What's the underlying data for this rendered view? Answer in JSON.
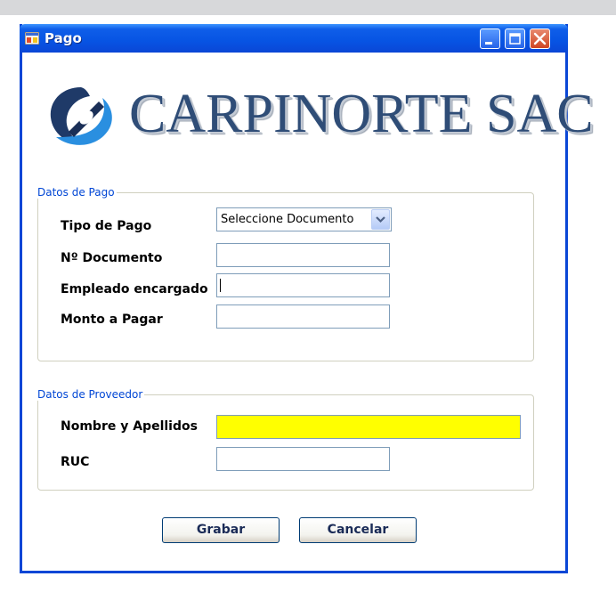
{
  "window": {
    "title": "Pago"
  },
  "logo": {
    "text": "CARPINORTE SAC"
  },
  "group_pago": {
    "legend": "Datos de Pago",
    "tipo_pago": {
      "label": "Tipo de Pago",
      "selected": "Seleccione Documento"
    },
    "num_documento": {
      "label": "Nº Documento",
      "value": ""
    },
    "empleado": {
      "label": "Empleado encargado",
      "value": ""
    },
    "monto": {
      "label": "Monto a Pagar",
      "value": ""
    }
  },
  "group_proveedor": {
    "legend": "Datos de Proveedor",
    "nombre": {
      "label": "Nombre y Apellidos",
      "value": "",
      "background": "#ffff00"
    },
    "ruc": {
      "label": "RUC",
      "value": ""
    }
  },
  "buttons": {
    "grabar": "Grabar",
    "cancelar": "Cancelar"
  },
  "colors": {
    "titlebar": "#0a46d6",
    "legend": "#0046d5",
    "highlight_field": "#ffff00",
    "logo_text": "#2f4d77"
  },
  "icons": [
    "app-icon",
    "minimize-icon",
    "maximize-icon",
    "close-icon",
    "logo-mark-icon",
    "chevron-down-icon"
  ]
}
